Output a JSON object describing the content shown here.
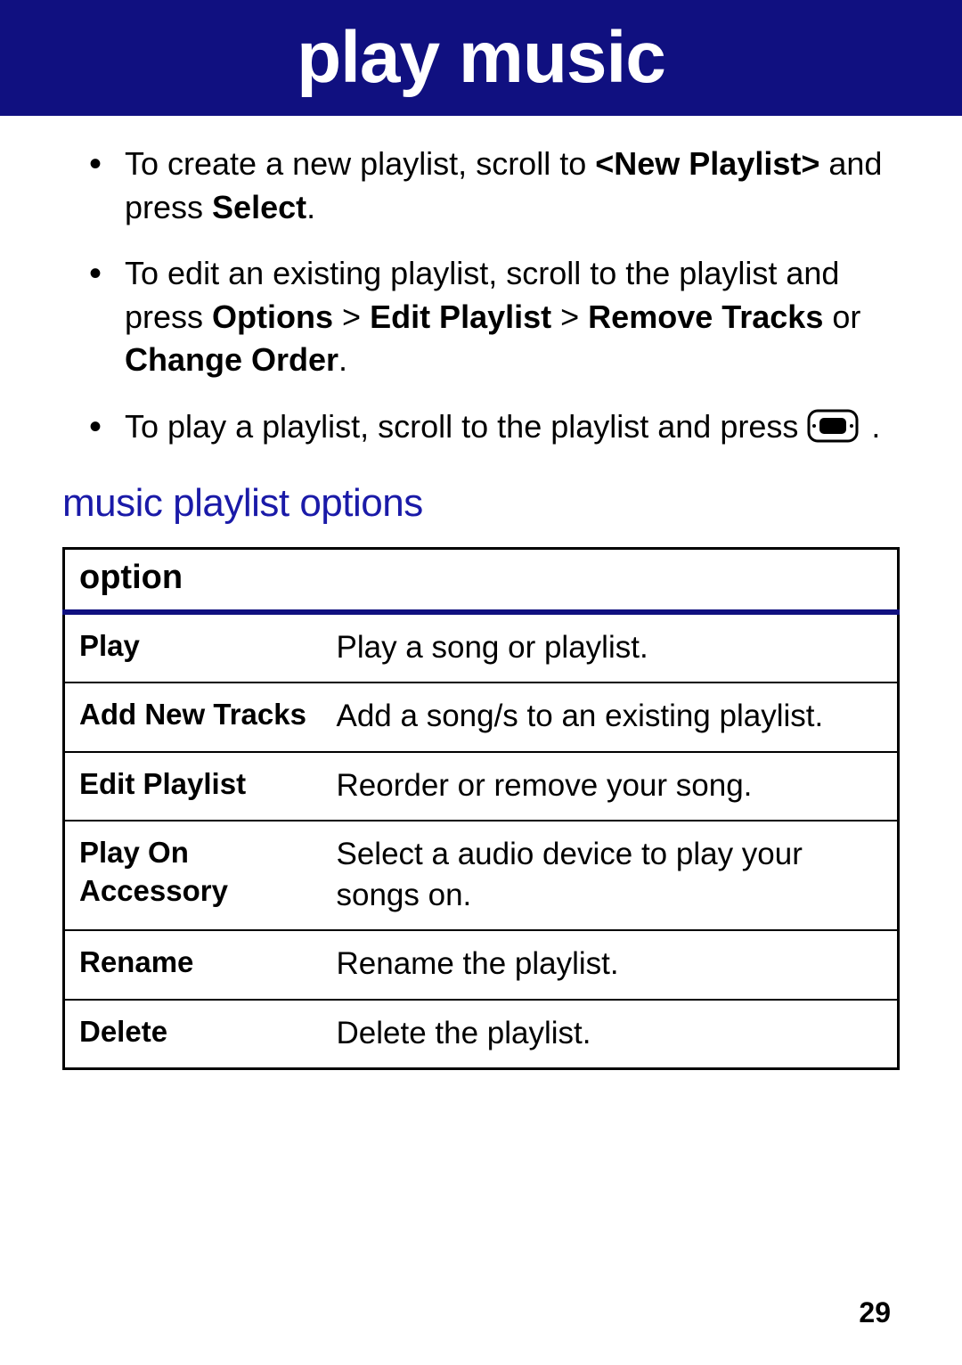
{
  "header": {
    "title": "play music"
  },
  "bullets": [
    {
      "pre": "To create a new playlist, scroll to ",
      "bold1": "<New Playlist>",
      "mid1": " and press ",
      "bold2": "Select",
      "post": "."
    },
    {
      "pre": "To edit an existing playlist, scroll to the playlist and press ",
      "bold1": "Options",
      "mid1": " > ",
      "bold2": "Edit Playlist",
      "mid2": " > ",
      "bold3": "Remove Tracks",
      "mid3": " or ",
      "bold4": "Change Order",
      "post": "."
    },
    {
      "pre": "To play a playlist, scroll to the playlist and press ",
      "icon": "select-key-icon",
      "post": " ."
    }
  ],
  "section_heading": "music playlist options",
  "table": {
    "header": "option",
    "rows": [
      {
        "opt": "Play",
        "desc": "Play a song or playlist."
      },
      {
        "opt": "Add New Tracks",
        "desc": "Add a song/s to an existing playlist."
      },
      {
        "opt": "Edit Playlist",
        "desc": "Reorder or remove your song."
      },
      {
        "opt": "Play On Accessory",
        "desc": "Select a audio device to play your songs on."
      },
      {
        "opt": "Rename",
        "desc": "Rename the playlist."
      },
      {
        "opt": "Delete",
        "desc": "Delete the playlist."
      }
    ]
  },
  "page_number": "29"
}
